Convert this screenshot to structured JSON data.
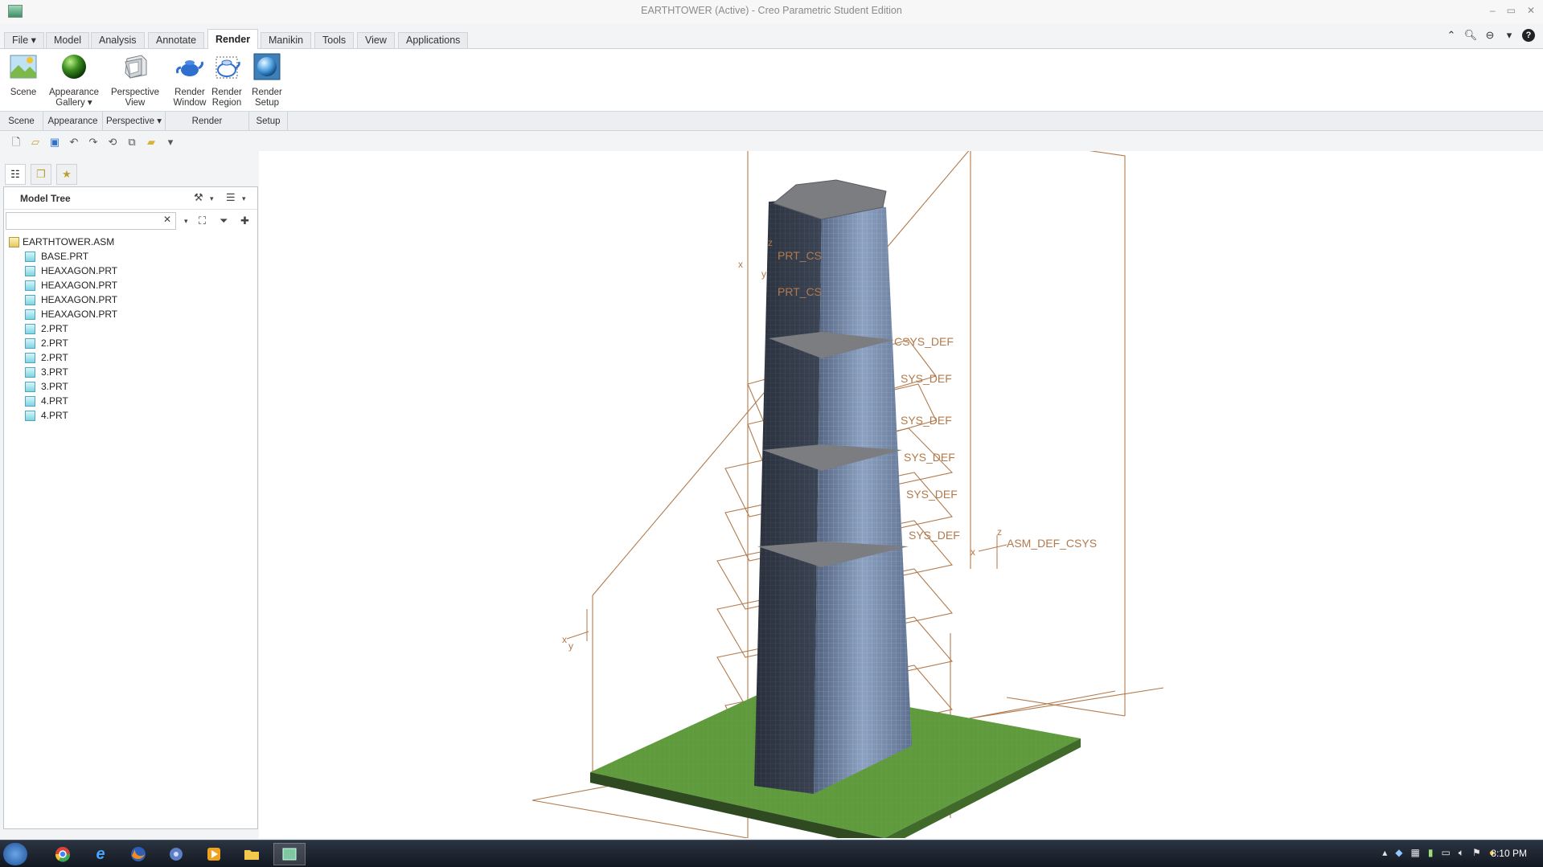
{
  "window": {
    "title": "EARTHTOWER (Active) - Creo Parametric Student Edition",
    "controls": [
      "–",
      "▭",
      "✕"
    ]
  },
  "tabs": [
    {
      "label": "File ▾"
    },
    {
      "label": "Model"
    },
    {
      "label": "Analysis"
    },
    {
      "label": "Annotate"
    },
    {
      "label": "Render",
      "active": true
    },
    {
      "label": "Manikin"
    },
    {
      "label": "Tools"
    },
    {
      "label": "View"
    },
    {
      "label": "Applications"
    }
  ],
  "ribbon": {
    "scene": "Scene",
    "appearance_l1": "Appearance",
    "appearance_l2": "Gallery ▾",
    "perspective_l1": "Perspective",
    "perspective_l2": "View",
    "render_window_l1": "Render",
    "render_window_l2": "Window",
    "render_region_l1": "Render",
    "render_region_l2": "Region",
    "render_setup_l1": "Render",
    "render_setup_l2": "Setup"
  },
  "groups": {
    "scene": "Scene",
    "appearance": "Appearance",
    "perspective": "Perspective ▾",
    "render": "Render",
    "setup": "Setup"
  },
  "model_tree": {
    "title": "Model Tree",
    "search_placeholder": "",
    "items": [
      {
        "label": "EARTHTOWER.ASM",
        "root": true
      },
      {
        "label": "BASE.PRT"
      },
      {
        "label": "HEAXAGON.PRT"
      },
      {
        "label": "HEAXAGON.PRT"
      },
      {
        "label": "HEAXAGON.PRT"
      },
      {
        "label": "HEAXAGON.PRT"
      },
      {
        "label": "2.PRT"
      },
      {
        "label": "2.PRT"
      },
      {
        "label": "2.PRT"
      },
      {
        "label": "3.PRT"
      },
      {
        "label": "3.PRT"
      },
      {
        "label": "4.PRT"
      },
      {
        "label": "4.PRT"
      }
    ]
  },
  "viewport": {
    "labels": {
      "prt_csys_1": "PRT_CS",
      "prt_csys_2": "PRT_CS",
      "csys_def_1": "CSYS_DEF",
      "csys_def_2": "SYS_DEF",
      "csys_def_3": "SYS_DEF",
      "csys_def_4": "SYS_DEF",
      "csys_def_5": "SYS_DEF",
      "csys_def_6": "SYS_DEF",
      "asm_def_csys": "ASM_DEF_CSYS",
      "axis_x": "x",
      "axis_y": "y",
      "axis_z": "z"
    }
  },
  "taskbar": {
    "clock": "8:10 PM"
  },
  "colors": {
    "accent": "#c07a40",
    "tower_dark": "#2b3240",
    "tower_glass": "#6e84a8",
    "roof": "#7b7d80",
    "grass": "#5f9a3c"
  }
}
